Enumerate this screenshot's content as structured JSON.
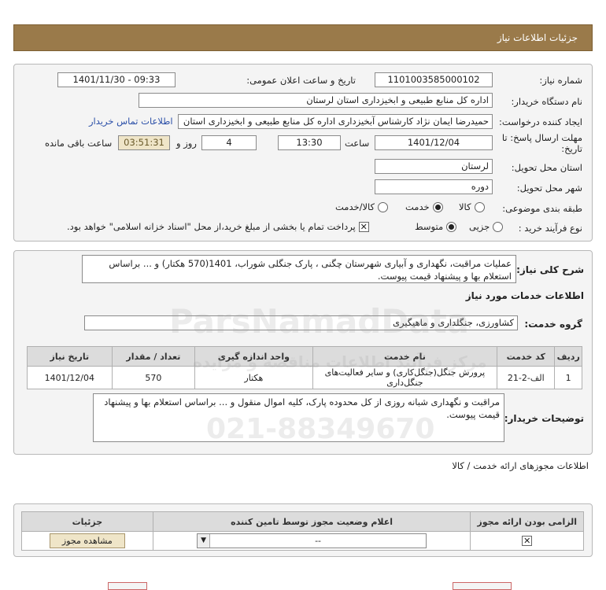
{
  "header": {
    "title": "جزئیات اطلاعات نیاز"
  },
  "form": {
    "need_number_label": "شماره نیاز:",
    "need_number": "1101003585000102",
    "announce_label": "تاریخ و ساعت اعلان عمومی:",
    "announce_value": "1401/11/30 - 09:33",
    "buyer_org_label": "نام دستگاه خریدار:",
    "buyer_org": "اداره کل منابع طبیعی و ابخیزداری استان لرستان",
    "creator_label": "ایجاد کننده درخواست:",
    "creator": "حمیدرضا ایمان نژاد کارشناس آبخیزداری اداره کل منابع طبیعی و ابخیزداری استان",
    "contact_link": "اطلاعات تماس خریدار",
    "deadline_label_1": "مهلت ارسال پاسخ: تا",
    "deadline_label_2": "تاریخ:",
    "deadline_date": "1401/12/04",
    "time_label": "ساعت",
    "deadline_time": "13:30",
    "days_value": "4",
    "days_label": "روز و",
    "remaining_time": "03:51:31",
    "remaining_label": "ساعت باقی مانده",
    "province_label": "استان محل تحویل:",
    "province": "لرستان",
    "city_label": "شهر محل تحویل:",
    "city": "دوره",
    "category_label": "طبقه بندی موضوعی:",
    "category_options": [
      "کالا",
      "خدمت",
      "کالا/خدمت"
    ],
    "category_selected": "خدمت",
    "process_label": "نوع فرآیند خرید :",
    "process_options": [
      "جزیی",
      "متوسط"
    ],
    "process_selected": "متوسط",
    "payment_note": "پرداخت تمام یا بخشی از مبلغ خرید،از محل \"اسناد خزانه اسلامی\" خواهد بود."
  },
  "description": {
    "label": "شرح کلی نیاز:",
    "text": "عملیات مراقبت، نگهداری و آبیاری شهرستان چگنی ، پارک جنگلی شوراب، 1401(570 هکتار) و ... براساس استعلام بها و پیشنهاد قیمت پیوست."
  },
  "services": {
    "section_title": "اطلاعات خدمات مورد نیاز",
    "group_label": "گروه خدمت:",
    "group_value": "کشاورزی، جنگلداری و ماهیگیری",
    "columns": [
      "ردیف",
      "کد خدمت",
      "نام خدمت",
      "واحد اندازه گیری",
      "تعداد / مقدار",
      "تاریخ نیاز"
    ],
    "rows": [
      [
        "1",
        "الف-2-21",
        "پرورش جنگل(جنگل‌کاری) و سایر فعالیت‌های جنگل‌داری",
        "هکتار",
        "570",
        "1401/12/04"
      ]
    ]
  },
  "buyer_notes": {
    "label": "توضیحات خریدار:",
    "text": "مراقبت و نگهداری شبانه روزی از کل محدوده پارک، کلیه اموال منقول و ... براساس استعلام بها و پیشنهاد قیمت پیوست."
  },
  "permits": {
    "section_title": "اطلاعات مجوزهای ارائه خدمت / کالا",
    "columns": [
      "الزامی بودن ارائه مجوز",
      "اعلام وضعیت مجوز توسط تامین کننده",
      "جزئیات"
    ],
    "status_value": "--",
    "view_button": "مشاهده مجوز"
  },
  "watermark": {
    "line1": "ParsNamadData",
    "line2": "مرکز فرآیند اطلاعات مناقصه و مزایده",
    "line3": "021-88349670"
  }
}
